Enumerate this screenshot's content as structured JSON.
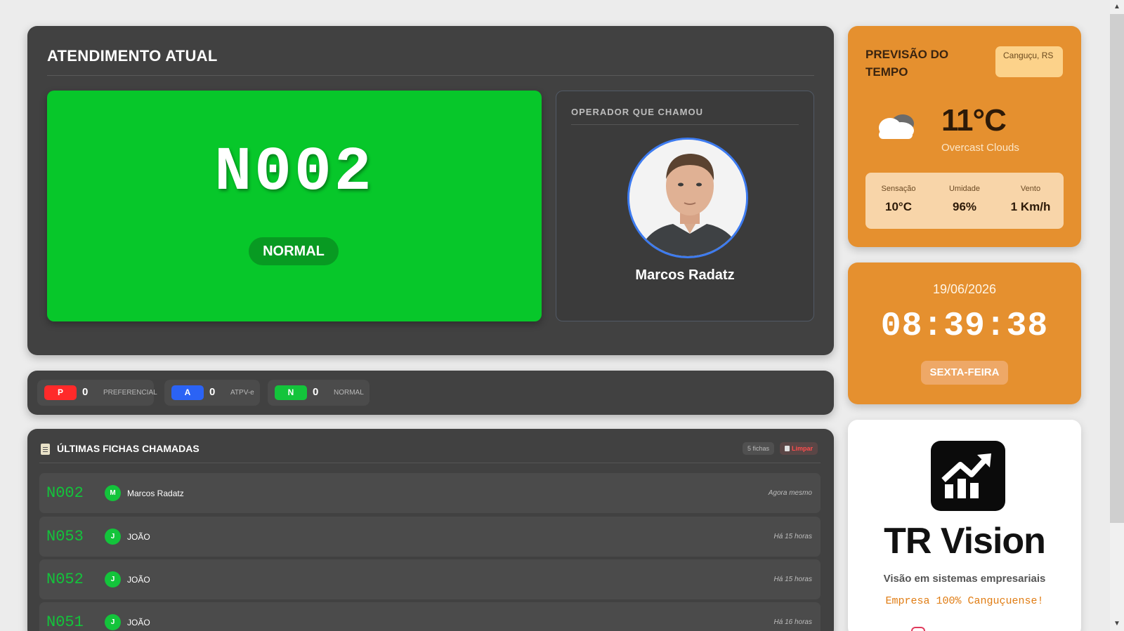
{
  "current": {
    "title": "ATENDIMENTO ATUAL",
    "ticket_number": "N002",
    "ticket_type": "NORMAL",
    "ticket_color": "#07c72a",
    "operator_label": "OPERADOR QUE CHAMOU",
    "operator_name": "Marcos Radatz"
  },
  "counters": [
    {
      "badge": "P",
      "count": "0",
      "label": "PREFERENCIAL",
      "color": "#ff2a2a"
    },
    {
      "badge": "A",
      "count": "0",
      "label": "ATPV-e",
      "color": "#2b63f5"
    },
    {
      "badge": "N",
      "count": "0",
      "label": "NORMAL",
      "color": "#13c43b"
    }
  ],
  "history": {
    "title": "ÚLTIMAS FICHAS CHAMADAS",
    "count_label": "5 fichas",
    "clear_label": "Limpar",
    "rows": [
      {
        "number": "N002",
        "initial": "M",
        "name": "Marcos Radatz",
        "time": "Agora mesmo"
      },
      {
        "number": "N053",
        "initial": "J",
        "name": "JOÃO",
        "time": "Há 15 horas"
      },
      {
        "number": "N052",
        "initial": "J",
        "name": "JOÃO",
        "time": "Há 15 horas"
      },
      {
        "number": "N051",
        "initial": "J",
        "name": "JOÃO",
        "time": "Há 16 horas"
      }
    ]
  },
  "weather": {
    "title": "PREVISÃO DO TEMPO",
    "city": "Canguçu, RS",
    "icon": "cloud-icon",
    "temperature": "11°C",
    "description": "Overcast Clouds",
    "stats": [
      {
        "label": "Sensação",
        "value": "10°C"
      },
      {
        "label": "Umidade",
        "value": "96%"
      },
      {
        "label": "Vento",
        "value": "1 Km/h"
      }
    ]
  },
  "clock": {
    "date": "19/06/2026",
    "time": "08:39:38",
    "weekday": "SEXTA-FEIRA"
  },
  "brand": {
    "name": "TR Vision",
    "slogan": "Visão em sistemas empresariais",
    "tagline": "Empresa 100% Canguçuense!",
    "logo_icon": "chart-trend-icon"
  },
  "colors": {
    "panel_dark": "#414141",
    "accent_orange": "#e5902f",
    "ticket_green": "#13c43b",
    "operator_ring": "#3d7bf0"
  }
}
